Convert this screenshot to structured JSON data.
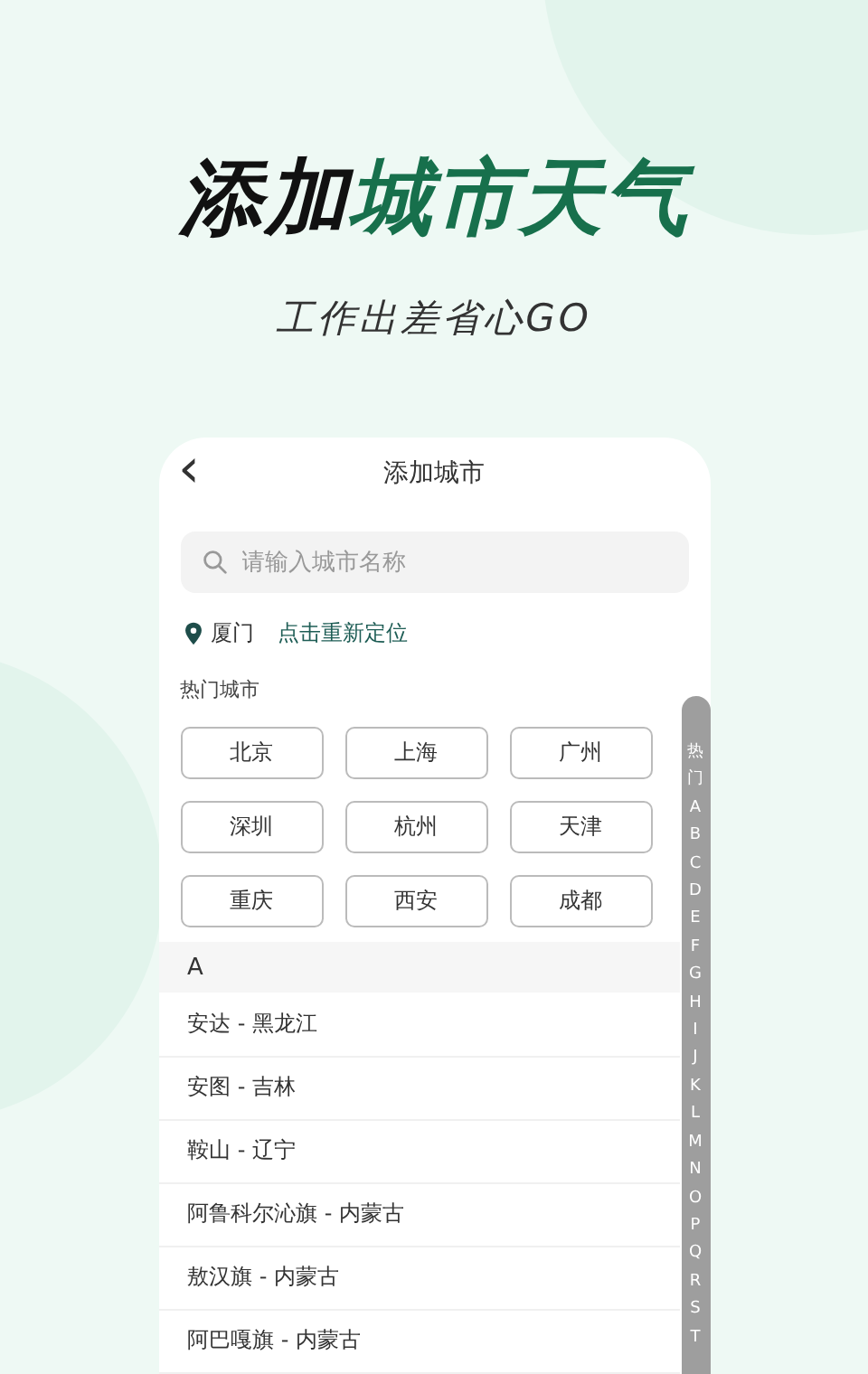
{
  "headline": {
    "dark": "添加",
    "accent": "城市天气"
  },
  "tagline": "工作出差省心GO",
  "header": {
    "back": "‹",
    "title": "添加城市"
  },
  "search": {
    "placeholder": "请输入城市名称"
  },
  "location": {
    "city": "厦门",
    "action": "点击重新定位"
  },
  "hot_cities": {
    "label": "热门城市",
    "items": [
      "北京",
      "上海",
      "广州",
      "深圳",
      "杭州",
      "天津",
      "重庆",
      "西安",
      "成都"
    ]
  },
  "sections": [
    {
      "letter": "A",
      "cities": [
        "安达 - 黑龙江",
        "安图 - 吉林",
        "鞍山 - 辽宁",
        "阿鲁科尔沁旗 - 内蒙古",
        "敖汉旗 - 内蒙古",
        "阿巴嘎旗 - 内蒙古"
      ]
    }
  ],
  "index": [
    "热",
    "门",
    "A",
    "B",
    "C",
    "D",
    "E",
    "F",
    "G",
    "H",
    "I",
    "J",
    "K",
    "L",
    "M",
    "N",
    "O",
    "P",
    "Q",
    "R",
    "S",
    "T"
  ]
}
